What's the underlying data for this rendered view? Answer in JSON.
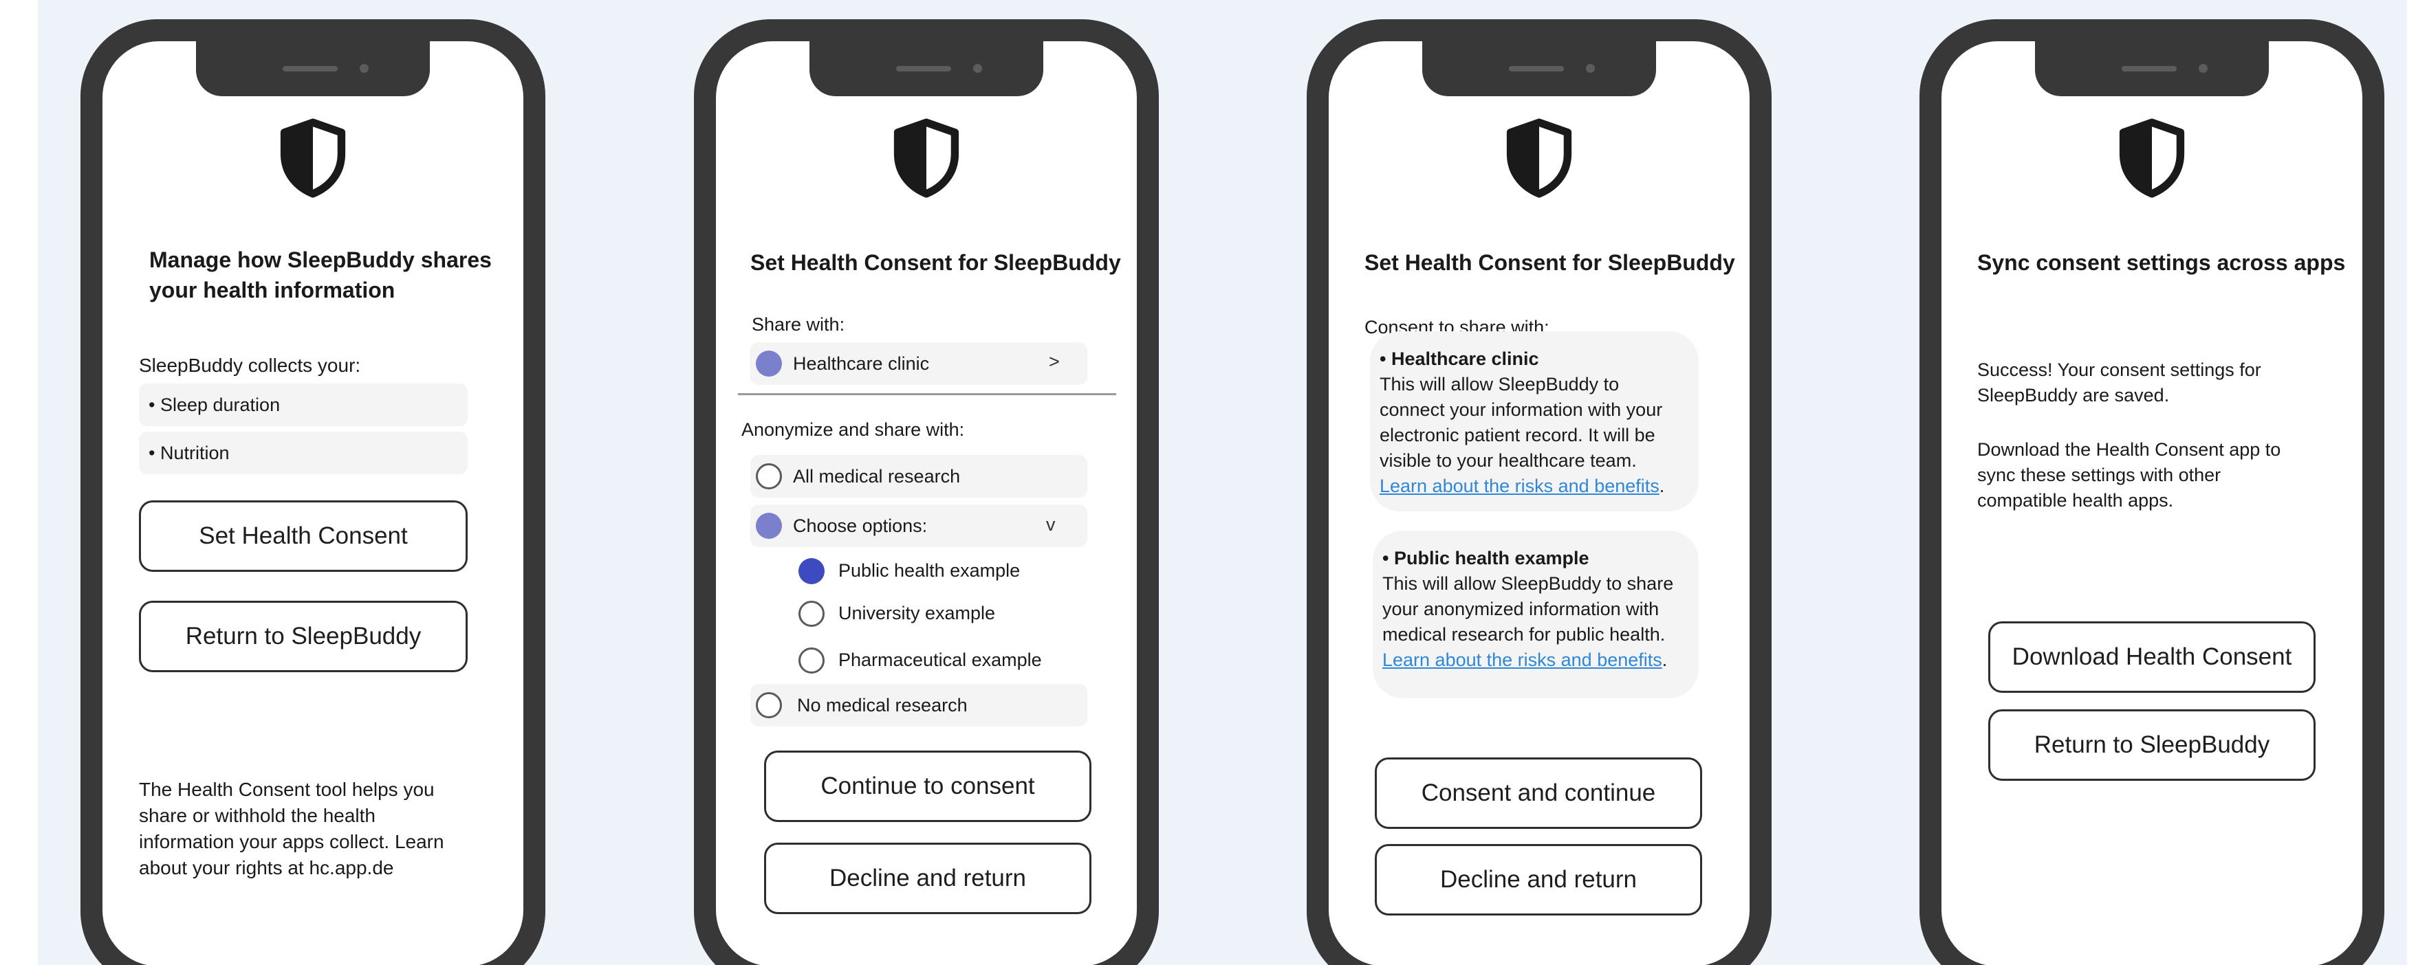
{
  "icons": {
    "shield": "shield-icon",
    "chevron_right": "chevron-right-icon",
    "chevron_down": "chevron-down-icon"
  },
  "colors": {
    "accent_light": "#7b80cc",
    "accent_dark": "#3d4ac0",
    "link": "#2f87d8",
    "phone_frame": "#383838",
    "canvas": "#eef2f9"
  },
  "screen1": {
    "title": "Manage how SleepBuddy shares your health information",
    "collects_label": "SleepBuddy collects your:",
    "items": [
      "• Sleep duration",
      "• Nutrition"
    ],
    "set_consent_button": "Set Health Consent",
    "return_button": "Return to SleepBuddy",
    "footer_text": "The Health Consent tool helps you share or withhold the health information your apps collect. Learn about your rights at hc.app.de"
  },
  "screen2": {
    "title": "Set Health Consent for SleepBuddy",
    "share_with_label": "Share with:",
    "share_option": "Healthcare clinic",
    "share_chevron": ">",
    "anonymize_label": "Anonymize and share with:",
    "options": {
      "all_research": "All medical research",
      "choose_options": "Choose options:",
      "choose_chevron": "v",
      "public_health": "Public health example",
      "university": "University example",
      "pharmaceutical": "Pharmaceutical example",
      "no_research": "No medical research"
    },
    "continue_button": "Continue to consent",
    "decline_button": "Decline and return"
  },
  "screen3": {
    "title": "Set Health Consent for SleepBuddy",
    "consent_label": "Consent to share with:",
    "cards": [
      {
        "heading": "• Healthcare clinic",
        "body": "This will allow SleepBuddy to connect your information with your electronic patient record. It will be visible to your healthcare team.",
        "link": "Learn about the risks and benefits",
        "tail": "."
      },
      {
        "heading": "• Public health example",
        "body": "This will allow SleepBuddy to share your anonymized information with medical research for public health.",
        "link": "Learn about the risks and benefits",
        "tail": "."
      }
    ],
    "consent_button": "Consent and continue",
    "decline_button": "Decline and return"
  },
  "screen4": {
    "title": "Sync consent settings across apps",
    "success_text": "Success! Your consent settings for SleepBuddy are saved.",
    "download_text": "Download the Health Consent app to sync these settings with other compatible health apps.",
    "download_button": "Download Health Consent",
    "return_button": "Return to SleepBuddy"
  }
}
